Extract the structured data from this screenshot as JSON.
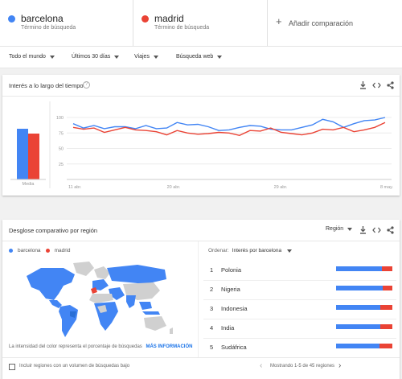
{
  "terms": [
    {
      "name": "barcelona",
      "sub": "Término de búsqueda",
      "color": "#4285f4"
    },
    {
      "name": "madrid",
      "sub": "Término de búsqueda",
      "color": "#ea4335"
    }
  ],
  "add_comparison": {
    "plus": "+",
    "label": "Añadir comparación"
  },
  "filters": [
    "Todo el mundo",
    "Últimos 30 días",
    "Viajes",
    "Búsqueda web"
  ],
  "interest": {
    "title": "Interés a lo largo del tiempo",
    "help": "?",
    "avg_label": "Media"
  },
  "chart_data": {
    "type": "line",
    "yticks": [
      100,
      75,
      50,
      25
    ],
    "ylim": [
      0,
      100
    ],
    "xticks": [
      "11 abr.",
      "20 abr.",
      "29 abr.",
      "8 may."
    ],
    "averages": {
      "barcelona": 84,
      "madrid": 76
    },
    "series": [
      {
        "name": "barcelona",
        "color": "#4285f4",
        "values": [
          90,
          83,
          87,
          82,
          85,
          85,
          82,
          87,
          82,
          83,
          92,
          88,
          89,
          85,
          79,
          80,
          84,
          87,
          86,
          81,
          80,
          80,
          84,
          88,
          97,
          93,
          84,
          90,
          95,
          96,
          100
        ]
      },
      {
        "name": "madrid",
        "color": "#ea4335",
        "values": [
          84,
          81,
          83,
          76,
          80,
          84,
          80,
          79,
          77,
          72,
          79,
          75,
          73,
          74,
          76,
          75,
          71,
          79,
          78,
          83,
          76,
          74,
          72,
          75,
          81,
          80,
          84,
          77,
          80,
          84,
          92
        ]
      }
    ]
  },
  "region": {
    "title": "Desglose comparativo por región",
    "level": "Región",
    "legend": [
      "barcelona",
      "madrid"
    ],
    "sort_label": "Ordenar:",
    "sort_value": "Interés por barcelona",
    "note": "La intensidad del color representa el porcentaje de búsquedas",
    "more": "MÁS INFORMACIÓN",
    "rows": [
      {
        "rank": "1",
        "name": "Polonia",
        "blue": 0.82
      },
      {
        "rank": "2",
        "name": "Nigeria",
        "blue": 0.83
      },
      {
        "rank": "3",
        "name": "Indonesia",
        "blue": 0.78
      },
      {
        "rank": "4",
        "name": "India",
        "blue": 0.79
      },
      {
        "rank": "5",
        "name": "Sudáfrica",
        "blue": 0.77
      }
    ],
    "low_volume": "Incluir regiones con un volumen de búsquedas bajo",
    "pagination": "Mostrando 1-5 de 45 regiones",
    "prev": "‹",
    "next": "›"
  }
}
